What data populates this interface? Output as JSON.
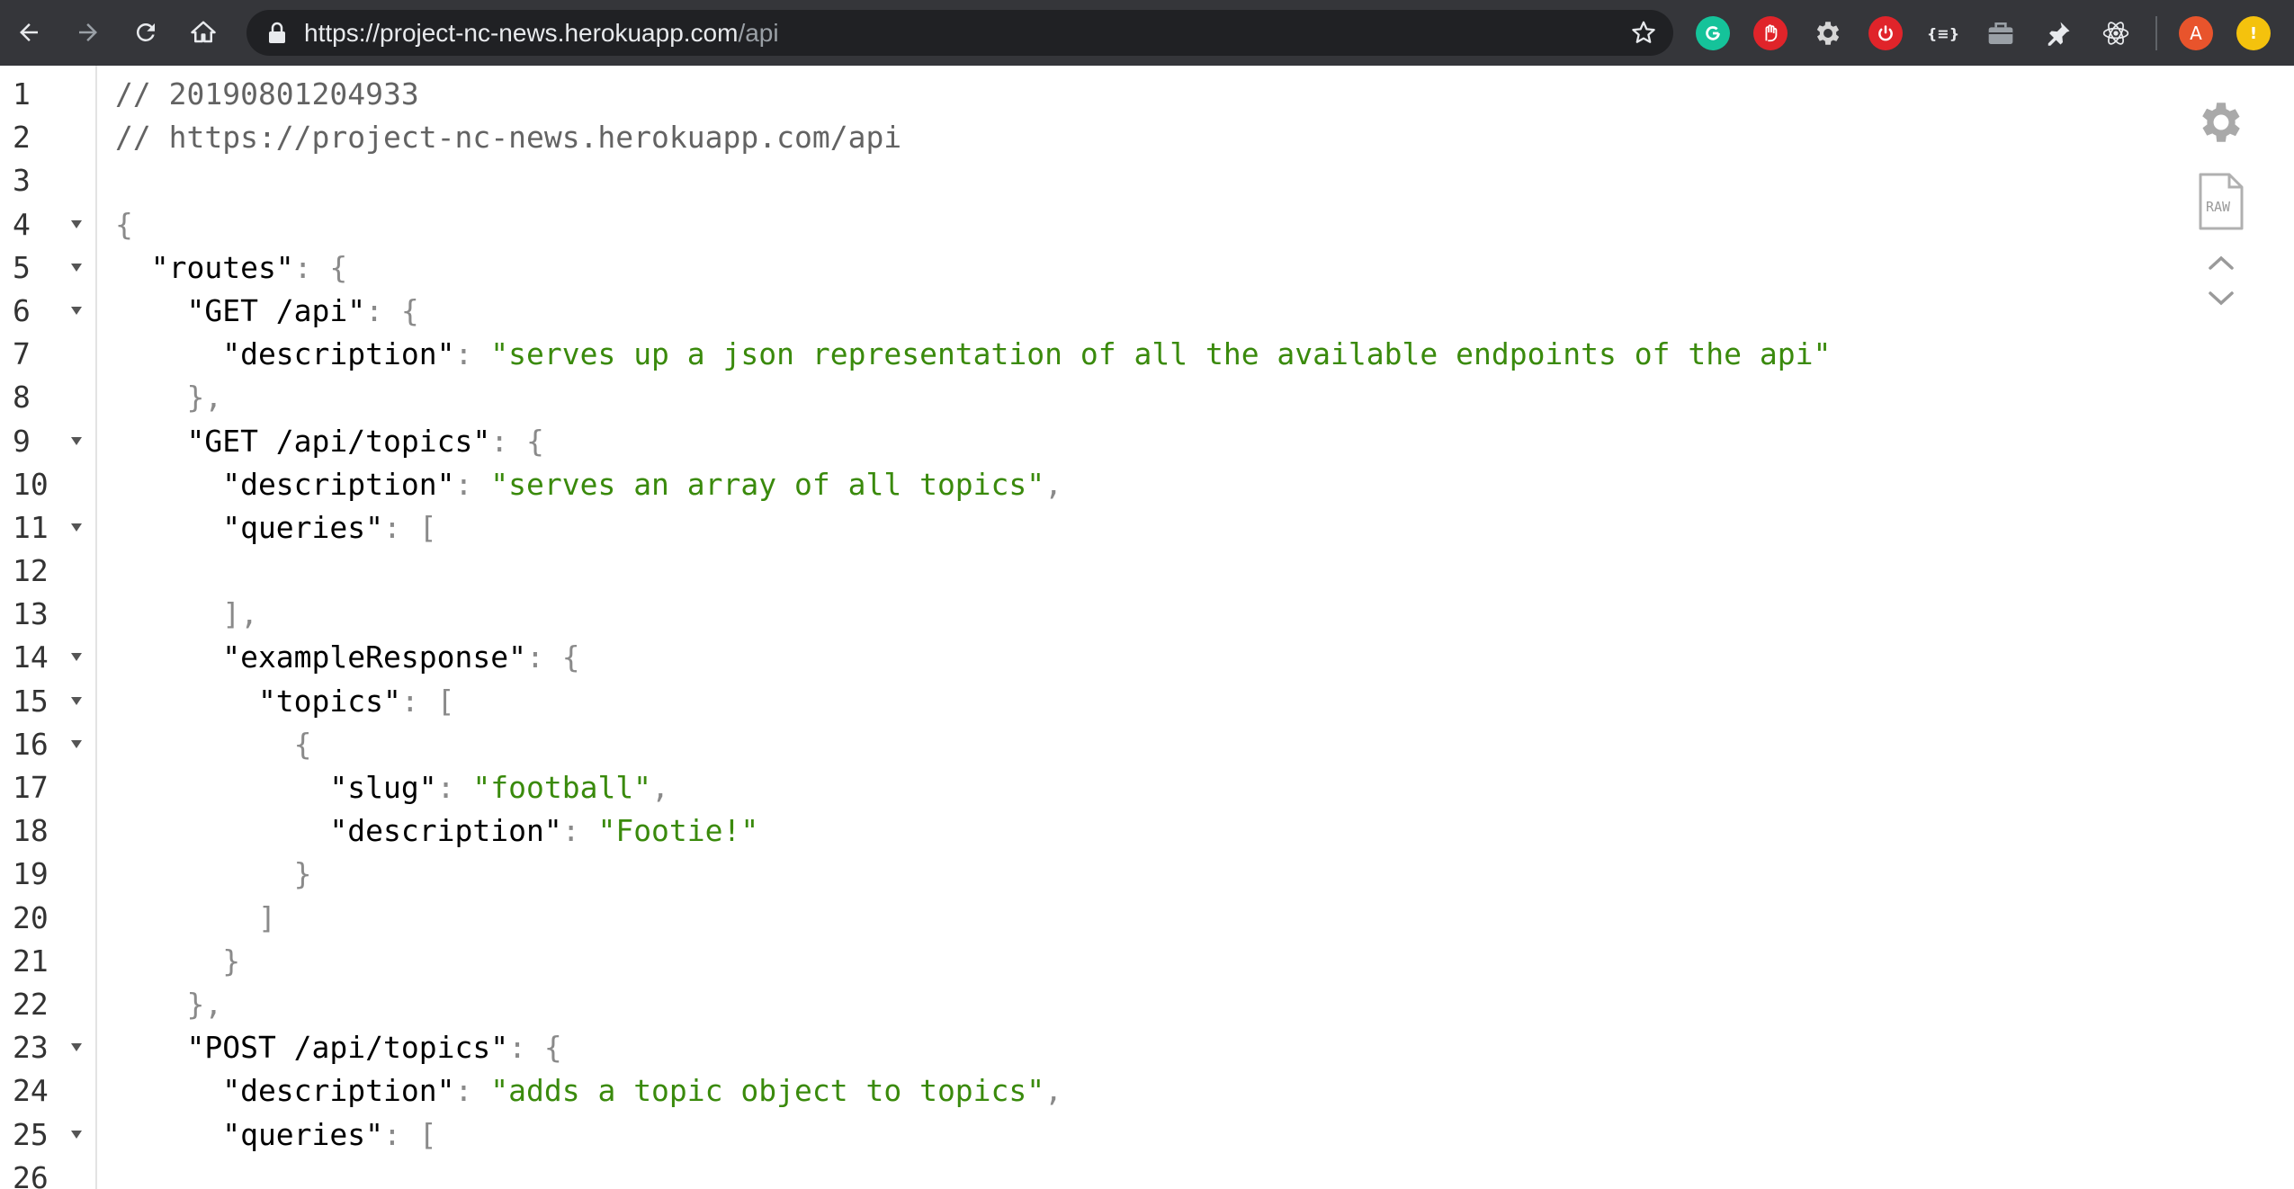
{
  "browser": {
    "url_main": "https://project-nc-news.herokuapp.com",
    "url_path": "/api",
    "icons": [
      "back-icon",
      "forward-icon",
      "reload-icon",
      "home-icon",
      "lock-icon",
      "star-icon"
    ],
    "extensions": [
      "grammarly-icon",
      "adblock-icon",
      "gear-extension-icon",
      "power-icon",
      "json-formatter-icon",
      "briefcase-icon",
      "pin-icon",
      "react-devtools-icon"
    ],
    "avatar_letter": "A",
    "colors": {
      "toolbar": "#35363a",
      "omnibox": "#202124",
      "avatar": "#e8542c",
      "update_dot": "#f4c20d"
    }
  },
  "viewer": {
    "controls": [
      "settings-gear-icon",
      "raw-icon",
      "collapse-up-icon",
      "expand-down-icon"
    ],
    "raw_label": "RAW",
    "colors": {
      "string": "#3a8a0c",
      "comment": "#636363",
      "key": "#000000",
      "punctuation": "#8a8a8a"
    },
    "lines": [
      {
        "n": "1",
        "parts": [
          {
            "t": "c",
            "v": "// 20190801204933"
          }
        ]
      },
      {
        "n": "2",
        "parts": [
          {
            "t": "c",
            "v": "// https://project-nc-news.herokuapp.com/api"
          }
        ]
      },
      {
        "n": "3",
        "parts": []
      },
      {
        "n": "4",
        "fold": true,
        "parts": [
          {
            "t": "p",
            "v": "{"
          }
        ]
      },
      {
        "n": "5",
        "fold": true,
        "parts": [
          {
            "t": "k",
            "v": "  \"routes\""
          },
          {
            "t": "p",
            "v": ": {"
          }
        ]
      },
      {
        "n": "6",
        "fold": true,
        "parts": [
          {
            "t": "k",
            "v": "    \"GET /api\""
          },
          {
            "t": "p",
            "v": ": {"
          }
        ]
      },
      {
        "n": "7",
        "parts": [
          {
            "t": "k",
            "v": "      \"description\""
          },
          {
            "t": "p",
            "v": ": "
          },
          {
            "t": "s",
            "v": "\"serves up a json representation of all the available endpoints of the api\""
          }
        ]
      },
      {
        "n": "8",
        "parts": [
          {
            "t": "p",
            "v": "    },"
          }
        ]
      },
      {
        "n": "9",
        "fold": true,
        "parts": [
          {
            "t": "k",
            "v": "    \"GET /api/topics\""
          },
          {
            "t": "p",
            "v": ": {"
          }
        ]
      },
      {
        "n": "10",
        "parts": [
          {
            "t": "k",
            "v": "      \"description\""
          },
          {
            "t": "p",
            "v": ": "
          },
          {
            "t": "s",
            "v": "\"serves an array of all topics\""
          },
          {
            "t": "p",
            "v": ","
          }
        ]
      },
      {
        "n": "11",
        "fold": true,
        "parts": [
          {
            "t": "k",
            "v": "      \"queries\""
          },
          {
            "t": "p",
            "v": ": ["
          }
        ]
      },
      {
        "n": "12",
        "parts": []
      },
      {
        "n": "13",
        "parts": [
          {
            "t": "p",
            "v": "      ],"
          }
        ]
      },
      {
        "n": "14",
        "fold": true,
        "parts": [
          {
            "t": "k",
            "v": "      \"exampleResponse\""
          },
          {
            "t": "p",
            "v": ": {"
          }
        ]
      },
      {
        "n": "15",
        "fold": true,
        "parts": [
          {
            "t": "k",
            "v": "        \"topics\""
          },
          {
            "t": "p",
            "v": ": ["
          }
        ]
      },
      {
        "n": "16",
        "fold": true,
        "parts": [
          {
            "t": "p",
            "v": "          {"
          }
        ]
      },
      {
        "n": "17",
        "parts": [
          {
            "t": "k",
            "v": "            \"slug\""
          },
          {
            "t": "p",
            "v": ": "
          },
          {
            "t": "s",
            "v": "\"football\""
          },
          {
            "t": "p",
            "v": ","
          }
        ]
      },
      {
        "n": "18",
        "parts": [
          {
            "t": "k",
            "v": "            \"description\""
          },
          {
            "t": "p",
            "v": ": "
          },
          {
            "t": "s",
            "v": "\"Footie!\""
          }
        ]
      },
      {
        "n": "19",
        "parts": [
          {
            "t": "p",
            "v": "          }"
          }
        ]
      },
      {
        "n": "20",
        "parts": [
          {
            "t": "p",
            "v": "        ]"
          }
        ]
      },
      {
        "n": "21",
        "parts": [
          {
            "t": "p",
            "v": "      }"
          }
        ]
      },
      {
        "n": "22",
        "parts": [
          {
            "t": "p",
            "v": "    },"
          }
        ]
      },
      {
        "n": "23",
        "fold": true,
        "parts": [
          {
            "t": "k",
            "v": "    \"POST /api/topics\""
          },
          {
            "t": "p",
            "v": ": {"
          }
        ]
      },
      {
        "n": "24",
        "parts": [
          {
            "t": "k",
            "v": "      \"description\""
          },
          {
            "t": "p",
            "v": ": "
          },
          {
            "t": "s",
            "v": "\"adds a topic object to topics\""
          },
          {
            "t": "p",
            "v": ","
          }
        ]
      },
      {
        "n": "25",
        "fold": true,
        "parts": [
          {
            "t": "k",
            "v": "      \"queries\""
          },
          {
            "t": "p",
            "v": ": ["
          }
        ]
      },
      {
        "n": "26",
        "parts": []
      }
    ]
  }
}
